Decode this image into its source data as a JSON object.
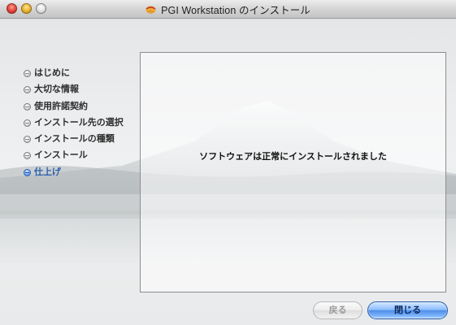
{
  "window": {
    "title": "PGI Workstation のインストール",
    "title_icon": "package-icon"
  },
  "traffic_lights": {
    "close": "close-icon",
    "minimize": "minimize-icon",
    "zoom": "zoom-icon"
  },
  "steps": [
    {
      "label": "はじめに",
      "active": false
    },
    {
      "label": "大切な情報",
      "active": false
    },
    {
      "label": "使用許諾契約",
      "active": false
    },
    {
      "label": "インストール先の選択",
      "active": false
    },
    {
      "label": "インストールの種類",
      "active": false
    },
    {
      "label": "インストール",
      "active": false
    },
    {
      "label": "仕上げ",
      "active": true
    }
  ],
  "content": {
    "message": "ソフトウェアは正常にインストールされました"
  },
  "buttons": {
    "back_label": "戻る",
    "close_label": "閉じる"
  },
  "colors": {
    "active_step": "#2b5fb0",
    "default_button": "#4f8ee6",
    "window_bg": "#e6e6e6"
  }
}
